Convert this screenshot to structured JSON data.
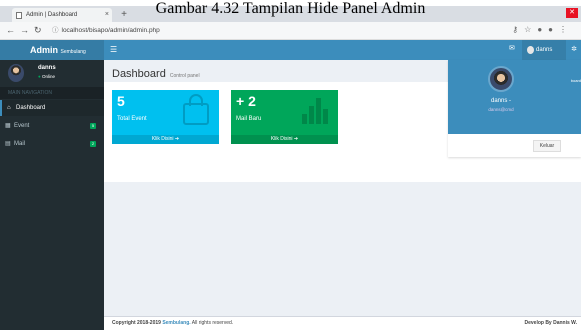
{
  "caption": "Gambar 4.32 Tampilan Hide Panel Admin",
  "browser": {
    "tab_title": "Admin | Dashboard",
    "tab_close": "×",
    "new_tab": "+",
    "url": "localhost/bisapo/admin/admin.php"
  },
  "app": {
    "brand_title": "Admin",
    "brand_subtitle": "Sembulang",
    "nav_user": "danns"
  },
  "sidebar": {
    "user_name": "danns",
    "status": "Online",
    "header": "MAIN NAVIGATION",
    "items": [
      {
        "label": "Dashboard",
        "badge": ""
      },
      {
        "label": "Event",
        "badge": "5"
      },
      {
        "label": "Mail",
        "badge": "2"
      }
    ]
  },
  "content": {
    "title": "Dashboard",
    "subtitle": "Control panel",
    "boxes": [
      {
        "number": "5",
        "label": "Total Event",
        "footer": "Klik Disini",
        "color": "#00c0ef"
      },
      {
        "number": "+ 2",
        "label": "Mail Baru",
        "footer": "Klik Disini",
        "color": "#00a65a"
      }
    ]
  },
  "user_dropdown": {
    "name": "danns -",
    "subtitle": "danns@cmd",
    "logout_label": "Keluar",
    "edge_text": "board"
  },
  "footer": {
    "copyright_prefix": "Copyright 2018-2019 ",
    "brand": "Sembulang.",
    "suffix": " All rights reserved.",
    "right": "Develop By Dannis W."
  },
  "colors": {
    "primary": "#3c8dbc",
    "sidebar_bg": "#222d32",
    "aqua": "#00c0ef",
    "green": "#00a65a"
  }
}
